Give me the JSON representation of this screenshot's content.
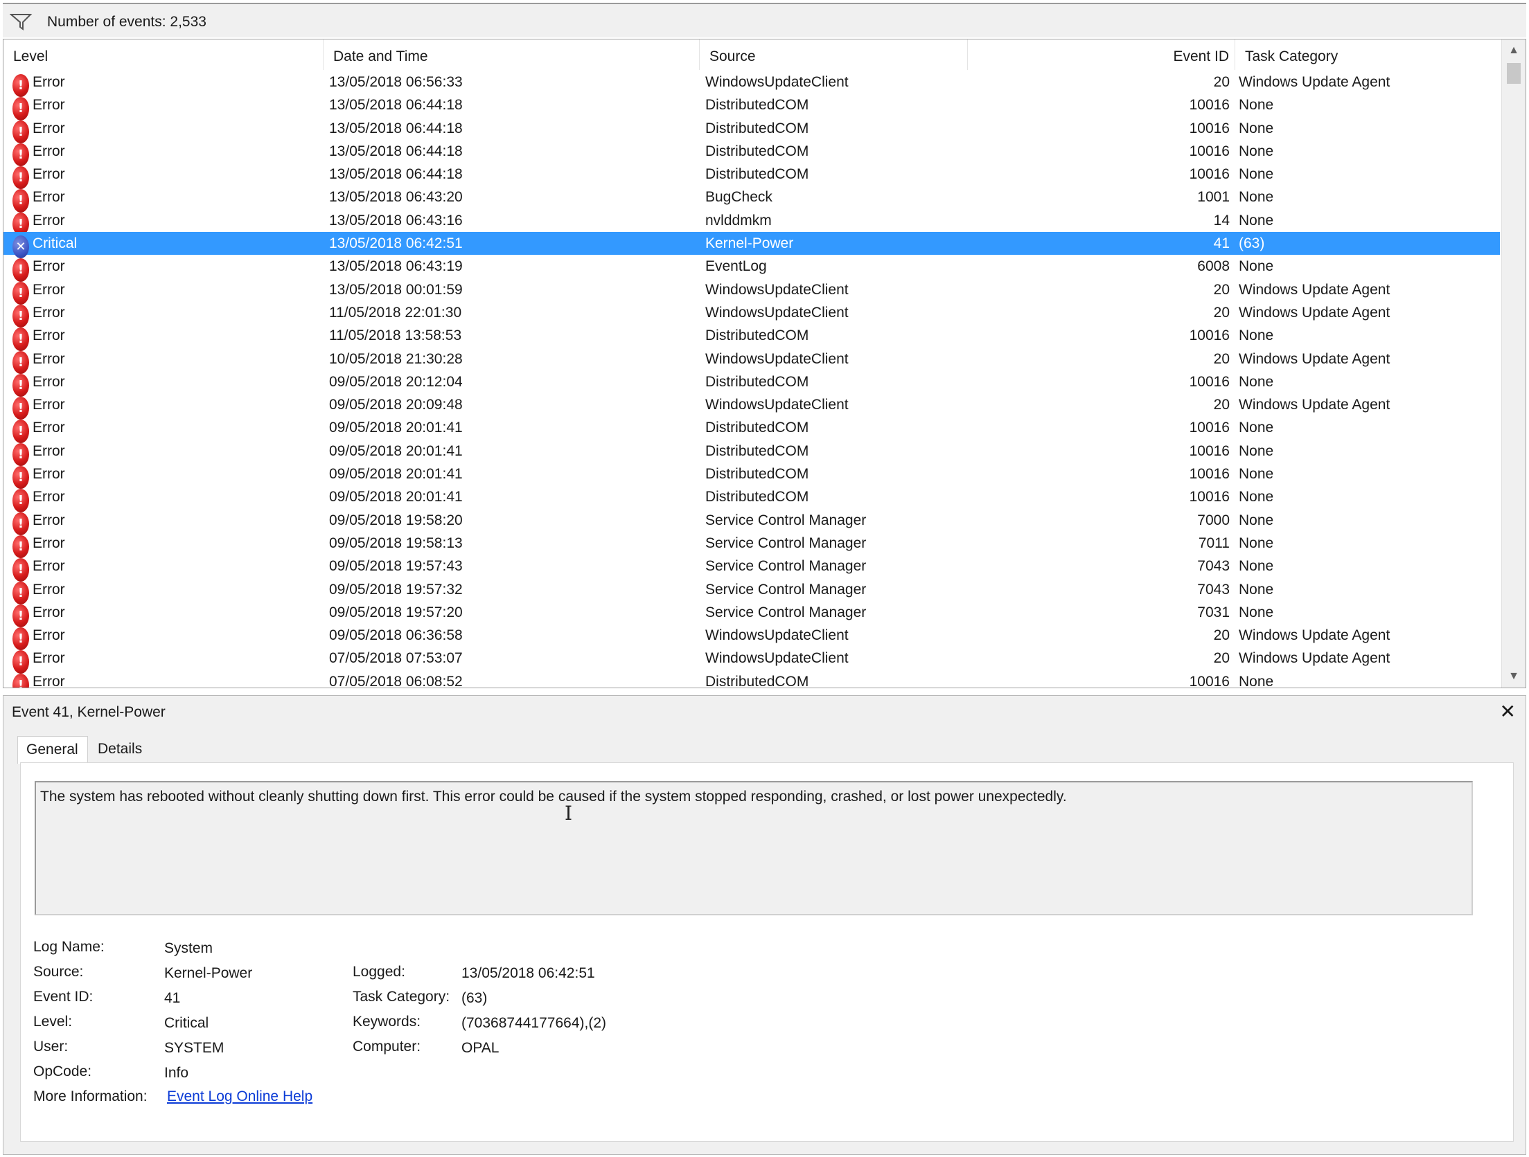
{
  "filterbar": {
    "event_count": "Number of events: 2,533"
  },
  "columns": {
    "level": "Level",
    "datetime": "Date and Time",
    "source": "Source",
    "event_id": "Event ID",
    "task_category": "Task Category"
  },
  "events": [
    {
      "level": "Error",
      "datetime": "13/05/2018 06:56:33",
      "source": "WindowsUpdateClient",
      "event_id": "20",
      "task": "Windows Update Agent",
      "icon": "error-icon"
    },
    {
      "level": "Error",
      "datetime": "13/05/2018 06:44:18",
      "source": "DistributedCOM",
      "event_id": "10016",
      "task": "None",
      "icon": "error-icon"
    },
    {
      "level": "Error",
      "datetime": "13/05/2018 06:44:18",
      "source": "DistributedCOM",
      "event_id": "10016",
      "task": "None",
      "icon": "error-icon"
    },
    {
      "level": "Error",
      "datetime": "13/05/2018 06:44:18",
      "source": "DistributedCOM",
      "event_id": "10016",
      "task": "None",
      "icon": "error-icon"
    },
    {
      "level": "Error",
      "datetime": "13/05/2018 06:44:18",
      "source": "DistributedCOM",
      "event_id": "10016",
      "task": "None",
      "icon": "error-icon"
    },
    {
      "level": "Error",
      "datetime": "13/05/2018 06:43:20",
      "source": "BugCheck",
      "event_id": "1001",
      "task": "None",
      "icon": "error-icon"
    },
    {
      "level": "Error",
      "datetime": "13/05/2018 06:43:16",
      "source": "nvlddmkm",
      "event_id": "14",
      "task": "None",
      "icon": "error-icon"
    },
    {
      "level": "Critical",
      "datetime": "13/05/2018 06:42:51",
      "source": "Kernel-Power",
      "event_id": "41",
      "task": "(63)",
      "icon": "critical-icon",
      "selected": true
    },
    {
      "level": "Error",
      "datetime": "13/05/2018 06:43:19",
      "source": "EventLog",
      "event_id": "6008",
      "task": "None",
      "icon": "error-icon"
    },
    {
      "level": "Error",
      "datetime": "13/05/2018 00:01:59",
      "source": "WindowsUpdateClient",
      "event_id": "20",
      "task": "Windows Update Agent",
      "icon": "error-icon"
    },
    {
      "level": "Error",
      "datetime": "11/05/2018 22:01:30",
      "source": "WindowsUpdateClient",
      "event_id": "20",
      "task": "Windows Update Agent",
      "icon": "error-icon"
    },
    {
      "level": "Error",
      "datetime": "11/05/2018 13:58:53",
      "source": "DistributedCOM",
      "event_id": "10016",
      "task": "None",
      "icon": "error-icon"
    },
    {
      "level": "Error",
      "datetime": "10/05/2018 21:30:28",
      "source": "WindowsUpdateClient",
      "event_id": "20",
      "task": "Windows Update Agent",
      "icon": "error-icon"
    },
    {
      "level": "Error",
      "datetime": "09/05/2018 20:12:04",
      "source": "DistributedCOM",
      "event_id": "10016",
      "task": "None",
      "icon": "error-icon"
    },
    {
      "level": "Error",
      "datetime": "09/05/2018 20:09:48",
      "source": "WindowsUpdateClient",
      "event_id": "20",
      "task": "Windows Update Agent",
      "icon": "error-icon"
    },
    {
      "level": "Error",
      "datetime": "09/05/2018 20:01:41",
      "source": "DistributedCOM",
      "event_id": "10016",
      "task": "None",
      "icon": "error-icon"
    },
    {
      "level": "Error",
      "datetime": "09/05/2018 20:01:41",
      "source": "DistributedCOM",
      "event_id": "10016",
      "task": "None",
      "icon": "error-icon"
    },
    {
      "level": "Error",
      "datetime": "09/05/2018 20:01:41",
      "source": "DistributedCOM",
      "event_id": "10016",
      "task": "None",
      "icon": "error-icon"
    },
    {
      "level": "Error",
      "datetime": "09/05/2018 20:01:41",
      "source": "DistributedCOM",
      "event_id": "10016",
      "task": "None",
      "icon": "error-icon"
    },
    {
      "level": "Error",
      "datetime": "09/05/2018 19:58:20",
      "source": "Service Control Manager",
      "event_id": "7000",
      "task": "None",
      "icon": "error-icon"
    },
    {
      "level": "Error",
      "datetime": "09/05/2018 19:58:13",
      "source": "Service Control Manager",
      "event_id": "7011",
      "task": "None",
      "icon": "error-icon"
    },
    {
      "level": "Error",
      "datetime": "09/05/2018 19:57:43",
      "source": "Service Control Manager",
      "event_id": "7043",
      "task": "None",
      "icon": "error-icon"
    },
    {
      "level": "Error",
      "datetime": "09/05/2018 19:57:32",
      "source": "Service Control Manager",
      "event_id": "7043",
      "task": "None",
      "icon": "error-icon"
    },
    {
      "level": "Error",
      "datetime": "09/05/2018 19:57:20",
      "source": "Service Control Manager",
      "event_id": "7031",
      "task": "None",
      "icon": "error-icon"
    },
    {
      "level": "Error",
      "datetime": "09/05/2018 06:36:58",
      "source": "WindowsUpdateClient",
      "event_id": "20",
      "task": "Windows Update Agent",
      "icon": "error-icon"
    },
    {
      "level": "Error",
      "datetime": "07/05/2018 07:53:07",
      "source": "WindowsUpdateClient",
      "event_id": "20",
      "task": "Windows Update Agent",
      "icon": "error-icon"
    },
    {
      "level": "Error",
      "datetime": "07/05/2018 06:08:52",
      "source": "DistributedCOM",
      "event_id": "10016",
      "task": "None",
      "icon": "error-icon"
    }
  ],
  "detail": {
    "title": "Event 41, Kernel-Power",
    "tabs": {
      "general": "General",
      "details": "Details"
    },
    "message": "The system has rebooted without cleanly shutting down first. This error could be caused if the system stopped responding, crashed, or lost power unexpectedly.",
    "labels": {
      "log_name": "Log Name:",
      "source": "Source:",
      "event_id": "Event ID:",
      "level": "Level:",
      "user": "User:",
      "opcode": "OpCode:",
      "more_info": "More Information:",
      "logged": "Logged:",
      "task_category": "Task Category:",
      "keywords": "Keywords:",
      "computer": "Computer:"
    },
    "values": {
      "log_name": "System",
      "source": "Kernel-Power",
      "event_id": "41",
      "level": "Critical",
      "user": "SYSTEM",
      "opcode": "Info",
      "more_info_link": "Event Log Online Help",
      "logged": "13/05/2018 06:42:51",
      "task_category": "(63)",
      "keywords": "(70368744177664),(2)",
      "computer": "OPAL"
    }
  },
  "colors": {
    "selection": "#3399ff",
    "link": "#0b3bd6",
    "error_icon": "#d61b1b",
    "critical_icon": "#3d55c4"
  }
}
